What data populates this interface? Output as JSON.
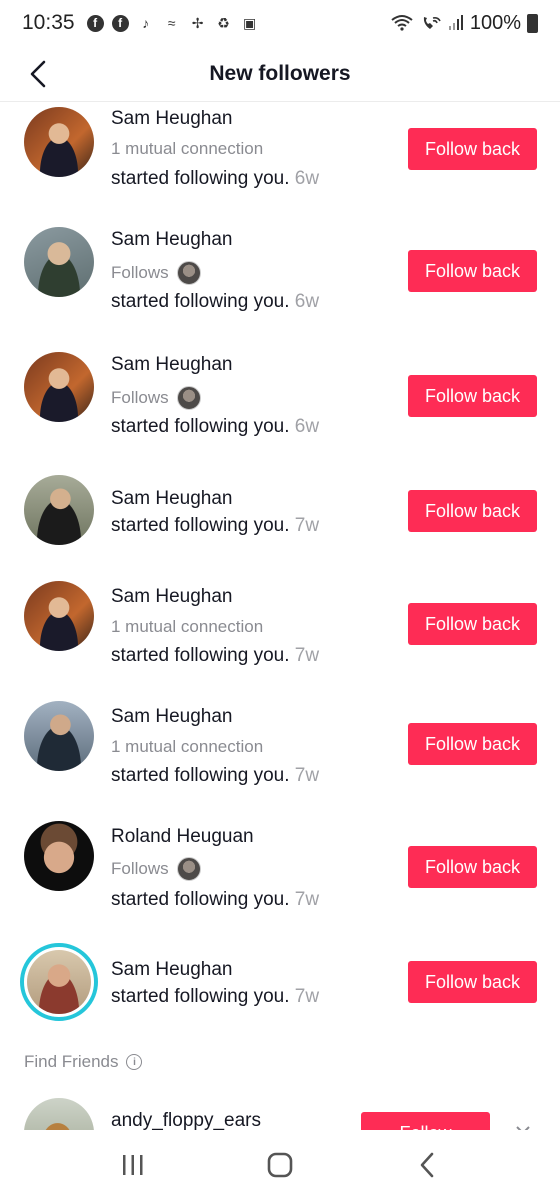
{
  "status_bar": {
    "time": "10:35",
    "battery": "100%",
    "icons": [
      "facebook-icon",
      "facebook-icon",
      "tiktok-icon",
      "sport-icon",
      "pinwheel-icon",
      "recycle-icon",
      "image-icon"
    ],
    "right_icons": [
      "wifi-icon",
      "wifi-call-icon",
      "signal-icon",
      "battery-icon"
    ]
  },
  "header": {
    "title": "New followers",
    "back_icon": "chevron-left-icon"
  },
  "followers": [
    {
      "name": "Sam Heughan",
      "subtitle": "1 mutual connection",
      "subtitle_type": "mutual",
      "action": "started following you.",
      "time": "6w",
      "button": "Follow back",
      "avatar_colors": [
        "#3a2418",
        "#b45a2c",
        "#e9c9a5"
      ]
    },
    {
      "name": "Sam Heughan",
      "subtitle": "Follows",
      "subtitle_type": "follows",
      "action": "started following you.",
      "time": "6w",
      "button": "Follow back",
      "avatar_colors": [
        "#6a7b80",
        "#3b4a3a",
        "#d6b99a"
      ]
    },
    {
      "name": "Sam Heughan",
      "subtitle": "Follows",
      "subtitle_type": "follows",
      "action": "started following you.",
      "time": "6w",
      "button": "Follow back",
      "avatar_colors": [
        "#3a2418",
        "#b45a2c",
        "#e9c9a5"
      ]
    },
    {
      "name": "Sam Heughan",
      "subtitle": "",
      "subtitle_type": "none",
      "action": "started following you.",
      "time": "7w",
      "button": "Follow back",
      "avatar_colors": [
        "#8a8f7a",
        "#1e1e1e",
        "#d4b08e"
      ]
    },
    {
      "name": "Sam Heughan",
      "subtitle": "1 mutual connection",
      "subtitle_type": "mutual",
      "action": "started following you.",
      "time": "7w",
      "button": "Follow back",
      "avatar_colors": [
        "#3a2418",
        "#b45a2c",
        "#e9c9a5"
      ]
    },
    {
      "name": "Sam Heughan",
      "subtitle": "1 mutual connection",
      "subtitle_type": "mutual",
      "action": "started following you.",
      "time": "7w",
      "button": "Follow back",
      "avatar_colors": [
        "#7d8a9c",
        "#1f2a36",
        "#cfa98a"
      ]
    },
    {
      "name": "Roland Heuguan",
      "subtitle": "Follows",
      "subtitle_type": "follows",
      "action": "started following you.",
      "time": "7w",
      "button": "Follow back",
      "avatar_colors": [
        "#0d0d0d",
        "#2a2a2a",
        "#d8a98a"
      ]
    },
    {
      "name": "Sam Heughan",
      "subtitle": "",
      "subtitle_type": "none",
      "action": "started following you.",
      "time": "7w",
      "button": "Follow back",
      "avatar_colors": [
        "#c9b59a",
        "#8b3a2e",
        "#d9a888"
      ]
    }
  ],
  "find_friends": {
    "title": "Find Friends",
    "suggestion": {
      "name": "andy_floppy_ears",
      "button": "Follow"
    }
  },
  "nav": {
    "recent": "recent-apps-icon",
    "home": "home-icon",
    "back": "back-icon"
  },
  "colors": {
    "accent": "#fe2c55",
    "ring": "#25c6da",
    "muted": "#8a8b91"
  }
}
